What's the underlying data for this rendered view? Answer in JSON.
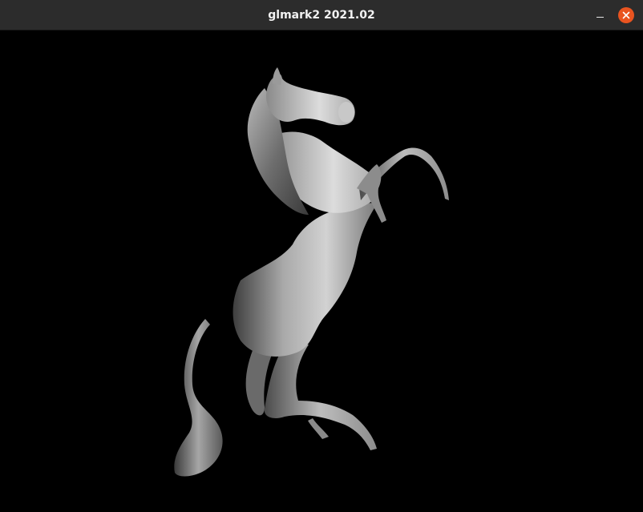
{
  "window": {
    "title": "glmark2 2021.02",
    "controls": [
      "minimize",
      "close"
    ]
  },
  "scene": {
    "background_color": "#000000",
    "subject": "rearing-horse-model",
    "shading": "grayscale"
  },
  "colors": {
    "titlebar": "#2c2c2c",
    "close_button": "#e95420",
    "title_text": "#f2f2f2"
  }
}
